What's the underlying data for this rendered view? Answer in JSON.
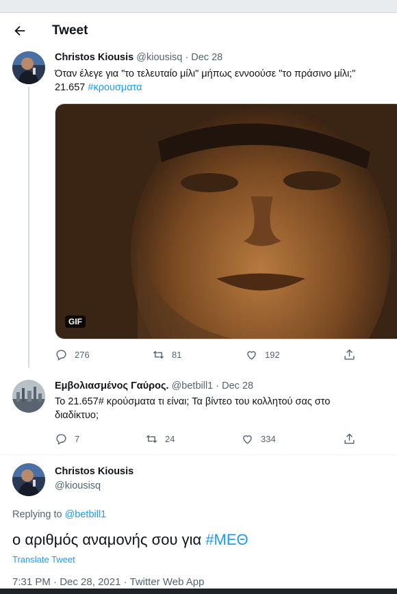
{
  "header": {
    "title": "Tweet"
  },
  "tweet1": {
    "author": "Christos Kiousis",
    "handle": "@kiousisq",
    "sep": " · ",
    "date": "Dec 28",
    "text_line1": "Όταν έλεγε για \"το τελευταίο μίλι\" μήπως εννοούσε \"το πράσινο μίλι;\"",
    "text_number": "21.657",
    "hashtag": "#κρουσματα",
    "media_badge": "GIF",
    "replies": "276",
    "retweets": "81",
    "likes": "192"
  },
  "tweet2": {
    "author": "Εμβολιασμένος Γαύρος.",
    "handle": "@betbill1",
    "sep": " · ",
    "date": "Dec 28",
    "text": "Το 21.657# κρούσματα τι είναι; Τα βίντεο του κολλητού σας στο διαδίκτυο;",
    "replies": "7",
    "retweets": "24",
    "likes": "334"
  },
  "main": {
    "author": "Christos Kiousis",
    "handle": "@kiousisq",
    "replying_prefix": "Replying to ",
    "replying_to": "@betbill1",
    "text": "ο αριθμός αναμονής σου για ",
    "hashtag": "#ΜΕΘ",
    "translate": "Translate Tweet",
    "time": "7:31 PM",
    "sep": " · ",
    "date": "Dec 28, 2021",
    "source": "Twitter Web App"
  },
  "icons": [
    "back-arrow-icon",
    "reply-icon",
    "retweet-icon",
    "like-icon",
    "share-icon"
  ],
  "colors": {
    "link": "#1d9bf0",
    "muted": "#536471",
    "text": "#0f1419"
  }
}
